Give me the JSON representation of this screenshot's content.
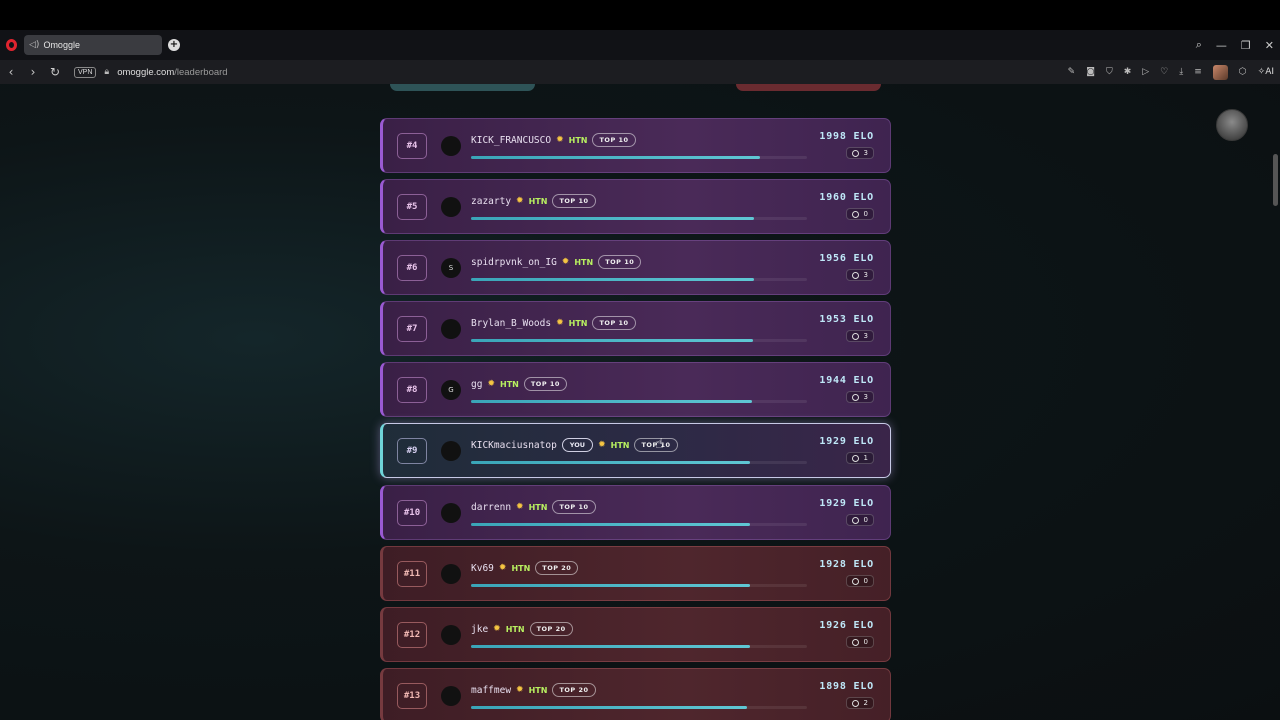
{
  "browser": {
    "tab_title": "Omoggle",
    "tab_favicon": "speaker-icon",
    "vpn_label": "VPN",
    "url_host": "omoggle.com",
    "url_path": "/leaderboard",
    "ai_label": "AI"
  },
  "leaderboard": {
    "elo_suffix": "ELO",
    "rows": [
      {
        "rank": "#4",
        "name": "KICK_FRANCUSCO",
        "htn": "HTN",
        "tier": "TOP 10",
        "elo": "1998",
        "messages": "3",
        "progress": 0.86,
        "theme": "purple",
        "avatar_initial": "",
        "is_you": false
      },
      {
        "rank": "#5",
        "name": "zazarty",
        "htn": "HTN",
        "tier": "TOP 10",
        "elo": "1960",
        "messages": "0",
        "progress": 0.843,
        "theme": "purple",
        "avatar_initial": "",
        "is_you": false
      },
      {
        "rank": "#6",
        "name": "spidrpvnk_on_IG",
        "htn": "HTN",
        "tier": "TOP 10",
        "elo": "1956",
        "messages": "3",
        "progress": 0.841,
        "theme": "purple",
        "avatar_initial": "S",
        "is_you": false
      },
      {
        "rank": "#7",
        "name": "Brylan_B_Woods",
        "htn": "HTN",
        "tier": "TOP 10",
        "elo": "1953",
        "messages": "3",
        "progress": 0.84,
        "theme": "purple",
        "avatar_initial": "",
        "is_you": false
      },
      {
        "rank": "#8",
        "name": "gg",
        "htn": "HTN",
        "tier": "TOP 10",
        "elo": "1944",
        "messages": "3",
        "progress": 0.836,
        "theme": "purple",
        "avatar_initial": "G",
        "is_you": false
      },
      {
        "rank": "#9",
        "name": "KICKmaciusnatop",
        "you_label": "YOU",
        "htn": "HTN",
        "tier": "TOP 10",
        "elo": "1929",
        "messages": "1",
        "progress": 0.83,
        "theme": "you",
        "avatar_initial": "",
        "is_you": true
      },
      {
        "rank": "#10",
        "name": "darrenn",
        "htn": "HTN",
        "tier": "TOP 10",
        "elo": "1929",
        "messages": "0",
        "progress": 0.83,
        "theme": "purple",
        "avatar_initial": "",
        "is_you": false
      },
      {
        "rank": "#11",
        "name": "Kv69",
        "htn": "HTN",
        "tier": "TOP 20",
        "elo": "1928",
        "messages": "0",
        "progress": 0.83,
        "theme": "red",
        "avatar_initial": "",
        "is_you": false
      },
      {
        "rank": "#12",
        "name": "jke",
        "htn": "HTN",
        "tier": "TOP 20",
        "elo": "1926",
        "messages": "0",
        "progress": 0.83,
        "theme": "red",
        "avatar_initial": "",
        "is_you": false
      },
      {
        "rank": "#13",
        "name": "maffmew",
        "htn": "HTN",
        "tier": "TOP 20",
        "elo": "1898",
        "messages": "2",
        "progress": 0.82,
        "theme": "red",
        "avatar_initial": "",
        "is_you": false
      }
    ]
  }
}
